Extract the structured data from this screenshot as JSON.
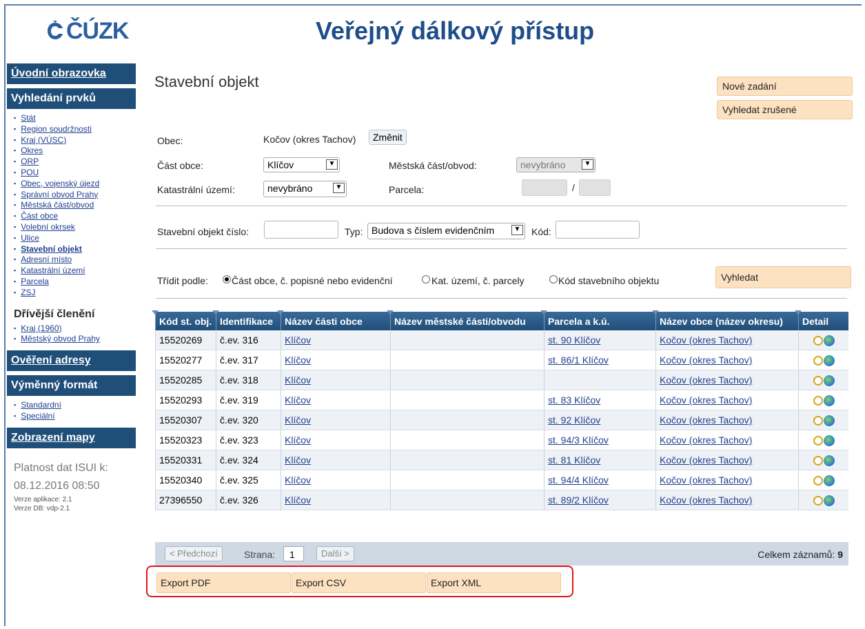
{
  "header": {
    "logo_text": "ČÚZK",
    "title": "Veřejný dálkový přístup"
  },
  "sidebar": {
    "uvodni": "Úvodní obrazovka",
    "vyhledani": "Vyhledání prvků",
    "items": [
      "Stát",
      "Region soudržnosti",
      "Kraj (VÚSC)",
      "Okres",
      "ORP",
      "POU",
      "Obec, vojenský újezd",
      "Správní obvod Prahy",
      "Městská část/obvod",
      "Část obce",
      "Volební okrsek",
      "Ulice",
      "Stavební objekt",
      "Adresní místo",
      "Katastrální území",
      "Parcela",
      "ZSJ"
    ],
    "drivejsi_title": "Dřívější členění",
    "drivejsi_items": [
      "Kraj (1960)",
      "Městský obvod Prahy"
    ],
    "overeni": "Ověření adresy",
    "vymenny": "Výměnný formát",
    "vymenny_items": [
      "Standardní",
      "Speciální"
    ],
    "zobrazeni": "Zobrazení mapy",
    "platnost_label": "Platnost dat ISUI k:",
    "platnost_date": "08.12.2016 08:50",
    "verze_app": "Verze aplikace: 2.1",
    "verze_db": "Verze DB: vdp-2.1"
  },
  "main": {
    "title": "Stavební objekt",
    "nove_zadani": "Nové zadání",
    "vyhledat_zrusene": "Vyhledat zrušené",
    "obec_label": "Obec:",
    "obec_value": "Kočov (okres Tachov)",
    "zmenit": "Změnit",
    "cast_obce_label": "Část obce:",
    "cast_obce_value": "Klíčov",
    "mestska_cast_label": "Městská část/obvod:",
    "mestska_cast_value": "nevybráno",
    "katastralni_label": "Katastrální území:",
    "katastralni_value": "nevybráno",
    "parcela_label": "Parcela:",
    "parcela_sep": "/",
    "so_cislo_label": "Stavební objekt číslo:",
    "typ_label": "Typ:",
    "typ_value": "Budova s číslem evidenčním",
    "kod_label": "Kód:",
    "tridit_label": "Třídit podle:",
    "radio1": "Část obce, č. popisné nebo evidenční",
    "radio2": "Kat. území, č. parcely",
    "radio3": "Kód stavebního objektu",
    "vyhledat": "Vyhledat"
  },
  "table": {
    "headers": [
      "Kód st. obj.",
      "Identifikace",
      "Název části obce",
      "Název městské části/obvodu",
      "Parcela a k.ú.",
      "Název obce (název okresu)",
      "Detail"
    ],
    "rows": [
      [
        "15520269",
        "č.ev. 316",
        "Klíčov",
        "",
        "st. 90 Klíčov",
        "Kočov (okres Tachov)"
      ],
      [
        "15520277",
        "č.ev. 317",
        "Klíčov",
        "",
        "st. 86/1 Klíčov",
        "Kočov (okres Tachov)"
      ],
      [
        "15520285",
        "č.ev. 318",
        "Klíčov",
        "",
        "",
        "Kočov (okres Tachov)"
      ],
      [
        "15520293",
        "č.ev. 319",
        "Klíčov",
        "",
        "st. 83 Klíčov",
        "Kočov (okres Tachov)"
      ],
      [
        "15520307",
        "č.ev. 320",
        "Klíčov",
        "",
        "st. 92 Klíčov",
        "Kočov (okres Tachov)"
      ],
      [
        "15520323",
        "č.ev. 323",
        "Klíčov",
        "",
        "st. 94/3 Klíčov",
        "Kočov (okres Tachov)"
      ],
      [
        "15520331",
        "č.ev. 324",
        "Klíčov",
        "",
        "st. 81 Klíčov",
        "Kočov (okres Tachov)"
      ],
      [
        "15520340",
        "č.ev. 325",
        "Klíčov",
        "",
        "st. 94/4 Klíčov",
        "Kočov (okres Tachov)"
      ],
      [
        "27396550",
        "č.ev. 326",
        "Klíčov",
        "",
        "st. 89/2 Klíčov",
        "Kočov (okres Tachov)"
      ]
    ]
  },
  "pager": {
    "prev": "< Předchozí",
    "strana_label": "Strana:",
    "page": "1",
    "next": "Další >",
    "total_label": "Celkem záznamů:",
    "total": "9"
  },
  "export": {
    "pdf": "Export PDF",
    "csv": "Export CSV",
    "xml": "Export XML"
  },
  "colors": {
    "nav_bg": "#1f4e79",
    "button_bg": "#fde2c2",
    "highlight_border": "#e0141c"
  }
}
